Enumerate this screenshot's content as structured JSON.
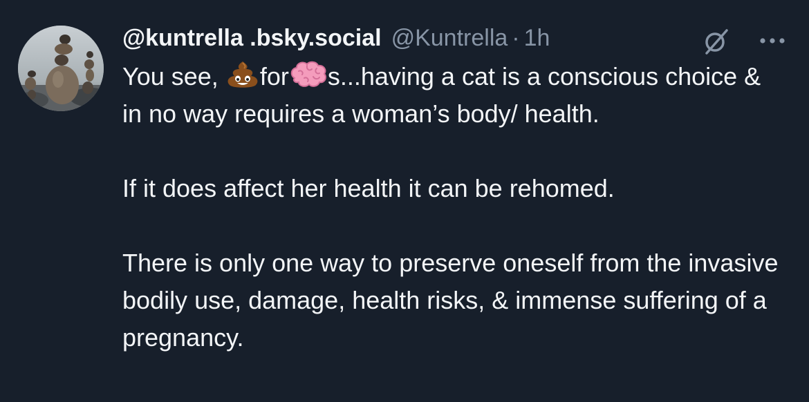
{
  "post": {
    "display_name": "@kuntrella .bsky.social",
    "handle": "@Kuntrella",
    "separator": "·",
    "timestamp": "1h",
    "avatar": "avatar-stacked-stones-image",
    "icons": {
      "verify": "slashed-circle-icon",
      "more": "more-options-icon"
    },
    "body": {
      "line1_a": "You see, ",
      "emoji_1": "pile-of-poo-emoji",
      "line1_b": "for",
      "emoji_2": "brain-emoji",
      "line1_c": "s...having a cat is a conscious choice & in no way requires a woman’s body/ health.",
      "paragraph_2": "If it does affect her health it can be rehomed.",
      "paragraph_3": "There is only one way to preserve oneself from the invasive bodily use, damage, health risks, & immense suffering of a pregnancy."
    }
  },
  "colors": {
    "background": "#171f2b",
    "text": "#f3f5f7",
    "muted": "#8895a6"
  }
}
